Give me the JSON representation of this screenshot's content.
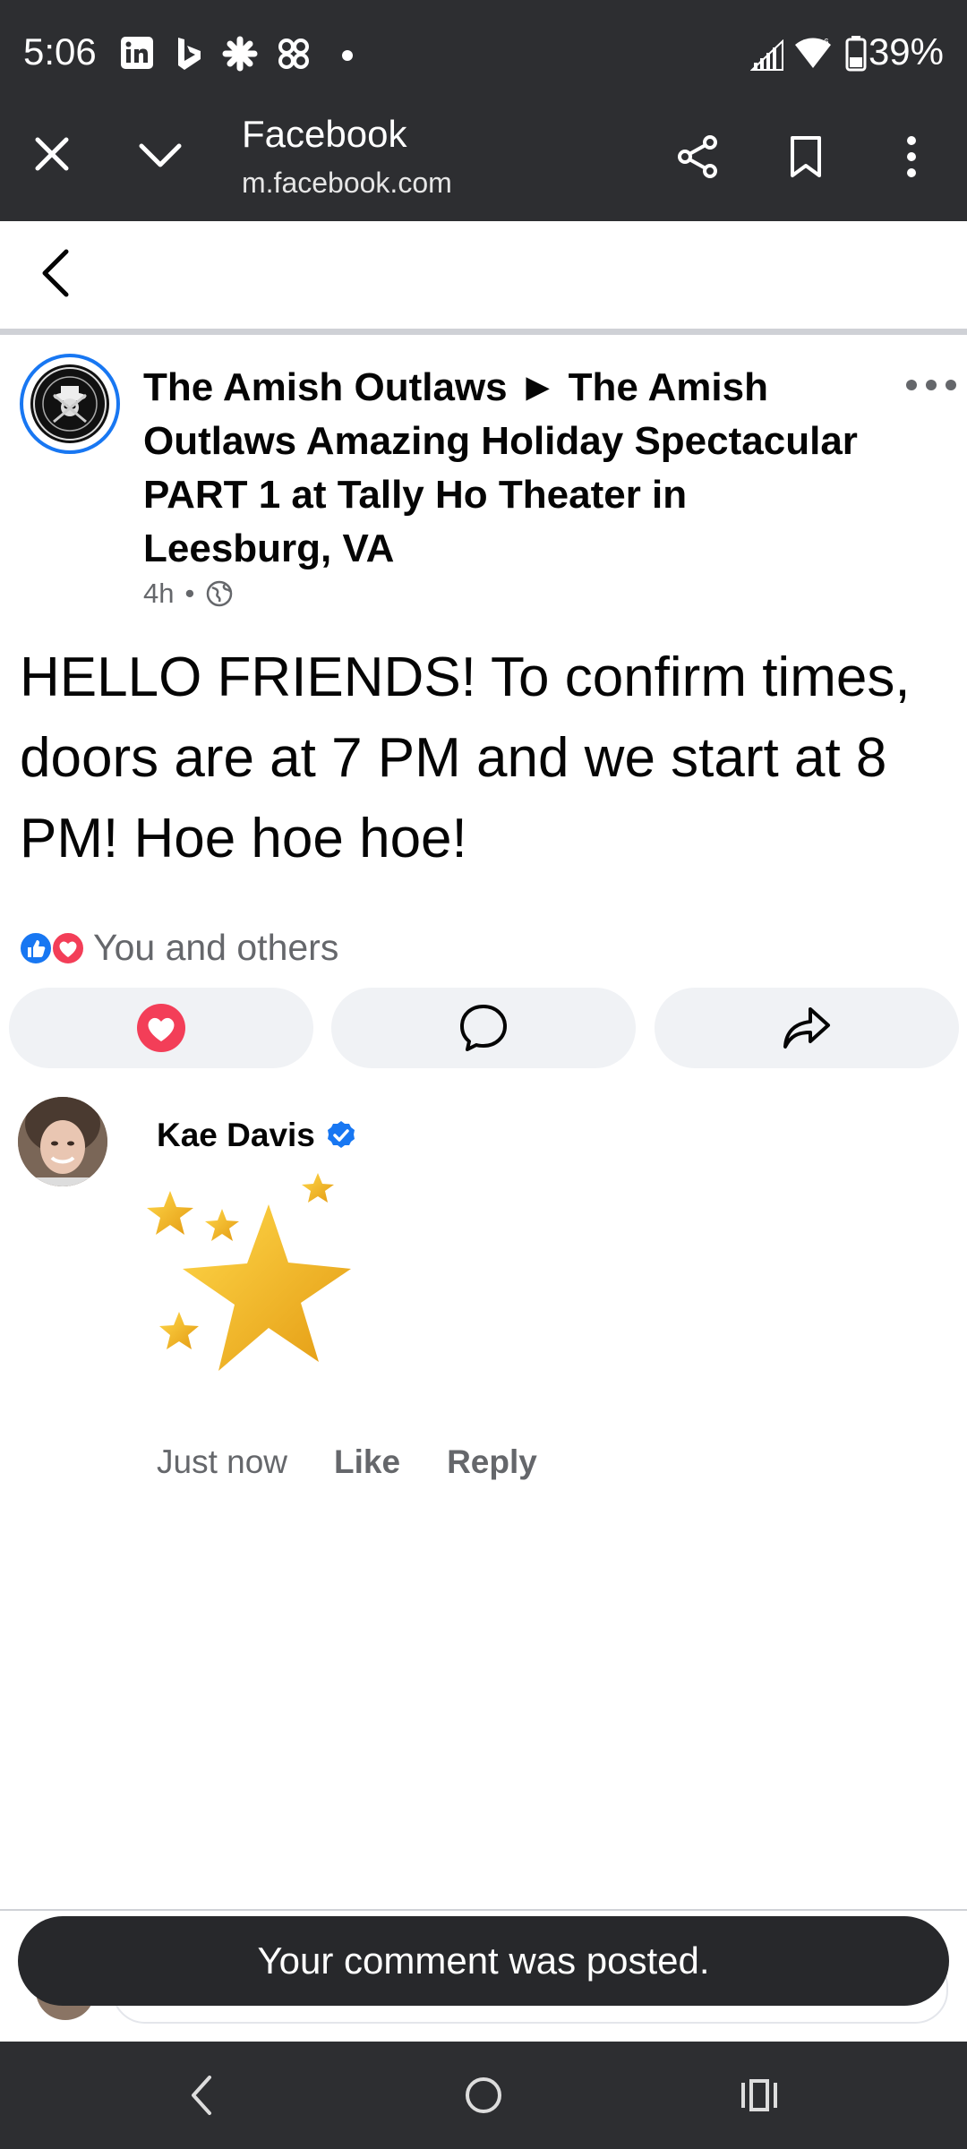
{
  "status_bar": {
    "time": "5:06",
    "battery": "39%",
    "notification_icons": [
      "linkedin-icon",
      "bing-icon",
      "slack-icon",
      "pinwheel-icon",
      "dot-icon"
    ]
  },
  "browser_tab": {
    "title": "Facebook",
    "url": "m.facebook.com"
  },
  "post": {
    "header": "The Amish Outlaws ► The Amish Outlaws Amazing Holiday Spectacular PART 1 at Tally Ho Theater in Leesburg, VA",
    "time": "4h",
    "separator": "•",
    "body": "HELLO FRIENDS! To confirm times, doors are at 7 PM and we start at 8 PM! Hoe hoe hoe!",
    "reactions_text": "You and others"
  },
  "comment": {
    "author": "Kae Davis",
    "time": "Just now",
    "like_label": "Like",
    "reply_label": "Reply"
  },
  "toast": {
    "message": "Your comment was posted."
  },
  "colors": {
    "bar_bg": "#2d2e31",
    "facebook_blue": "#1877f2",
    "love_red": "#f33e58",
    "secondary_text": "#65676b",
    "action_bg": "#f0f2f5"
  }
}
